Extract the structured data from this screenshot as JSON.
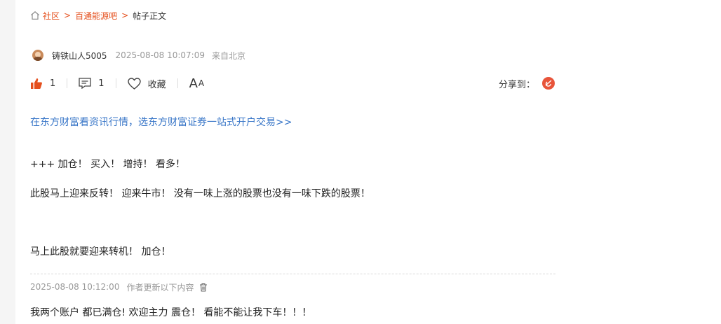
{
  "breadcrumb": {
    "items": [
      "社区",
      "百通能源吧"
    ],
    "current": "帖子正文"
  },
  "author": {
    "name": "铸铁山人5005",
    "time": "2025-08-08 10:07:09",
    "location": "来自北京"
  },
  "actions": {
    "like_count": "1",
    "comment_count": "1",
    "favorite_label": "收藏",
    "font_big": "A",
    "font_small": "A",
    "share_label": "分享到："
  },
  "promo": {
    "text": "在东方财富看资讯行情，选东方财富证券一站式开户交易>>"
  },
  "content": {
    "paragraphs": [
      "+++ 加仓！ 买入！ 增持！ 看多！",
      "此股马上迎来反转！ 迎来牛市！ 没有一味上涨的股票也没有一味下跌的股票！",
      "马上此股就要迎来转机！ 加仓！"
    ]
  },
  "update": {
    "time": "2025-08-08 10:12:00",
    "label": "作者更新以下内容",
    "text": "我两个账户 都已满仓! 欢迎主力 震仓！ 看能不能让我下车！！！"
  },
  "colors": {
    "accent": "#e5501e",
    "link": "#3a77c8",
    "share_icon": "#e8543a"
  },
  "icons": [
    "home-icon",
    "thumbs-up-icon",
    "comment-icon",
    "heart-icon",
    "share-weibo-icon",
    "trash-icon"
  ]
}
